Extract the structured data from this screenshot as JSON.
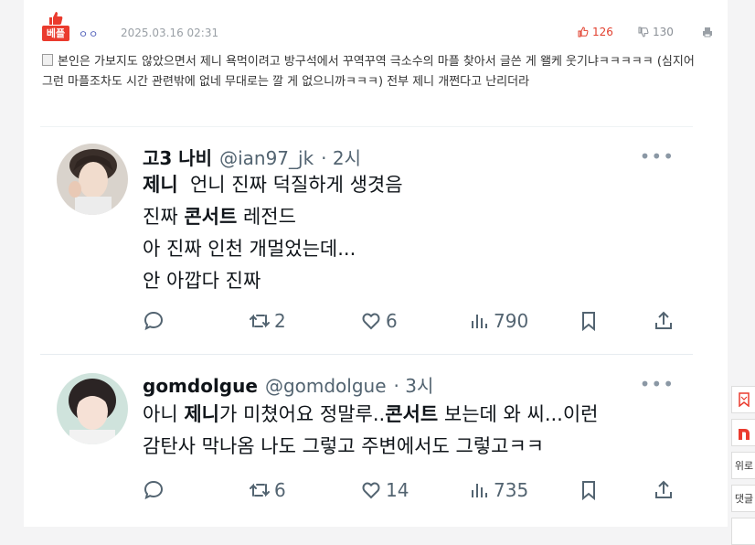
{
  "post": {
    "badge": "베플",
    "author": "ㅇㅇ",
    "date": "2025.03.16 02:31",
    "likes": "126",
    "dislikes": "130",
    "body": "본인은 가보지도 않았으면서 제니 욕먹이려고 방구석에서 꾸역꾸역 극소수의 마플 찾아서 글쓴 게 왤케 웃기냐ㅋㅋㅋㅋㅋ (심지어 그런 마플조차도 시간 관련밖에 없네 무대로는 깔 게 없으니까ㅋㅋㅋ) 전부 제니 개쩐다고 난리더라"
  },
  "tweets": [
    {
      "name": "고3 나비",
      "handle": "@ian97_jk",
      "time": "· 2시",
      "line1_bold": "제니",
      "line1_rest": "  언니 진짜 덕질하게 생겻음",
      "line2_pre": "진짜 ",
      "line2_bold": "콘서트",
      "line2_rest": " 레전드",
      "line3": "아 진짜 인천 개멀었는데...",
      "line4": "안 아깝다 진짜",
      "retweets": "2",
      "likes": "6",
      "views": "790",
      "more": "•••"
    },
    {
      "name": "gomdolgue",
      "handle": "@gomdolgue",
      "time": "· 3시",
      "line1_pre": "아니 ",
      "line1_bold": "제니",
      "line1_mid": "가 미쳤어요 정말루..",
      "line1_bold2": "콘서트",
      "line1_rest": " 보는데 와 씨...이런",
      "line2": "감탄사 막나옴 나도 그렇고 주변에서도 그렇고ㅋㅋ",
      "retweets": "6",
      "likes": "14",
      "views": "735",
      "more": "•••"
    }
  ],
  "side": {
    "btn3": "위로",
    "btn4": "댓글"
  },
  "colors": {
    "accent_red": "#ea3b2e",
    "twitter_text": "#0f1419",
    "twitter_muted": "#536471"
  }
}
